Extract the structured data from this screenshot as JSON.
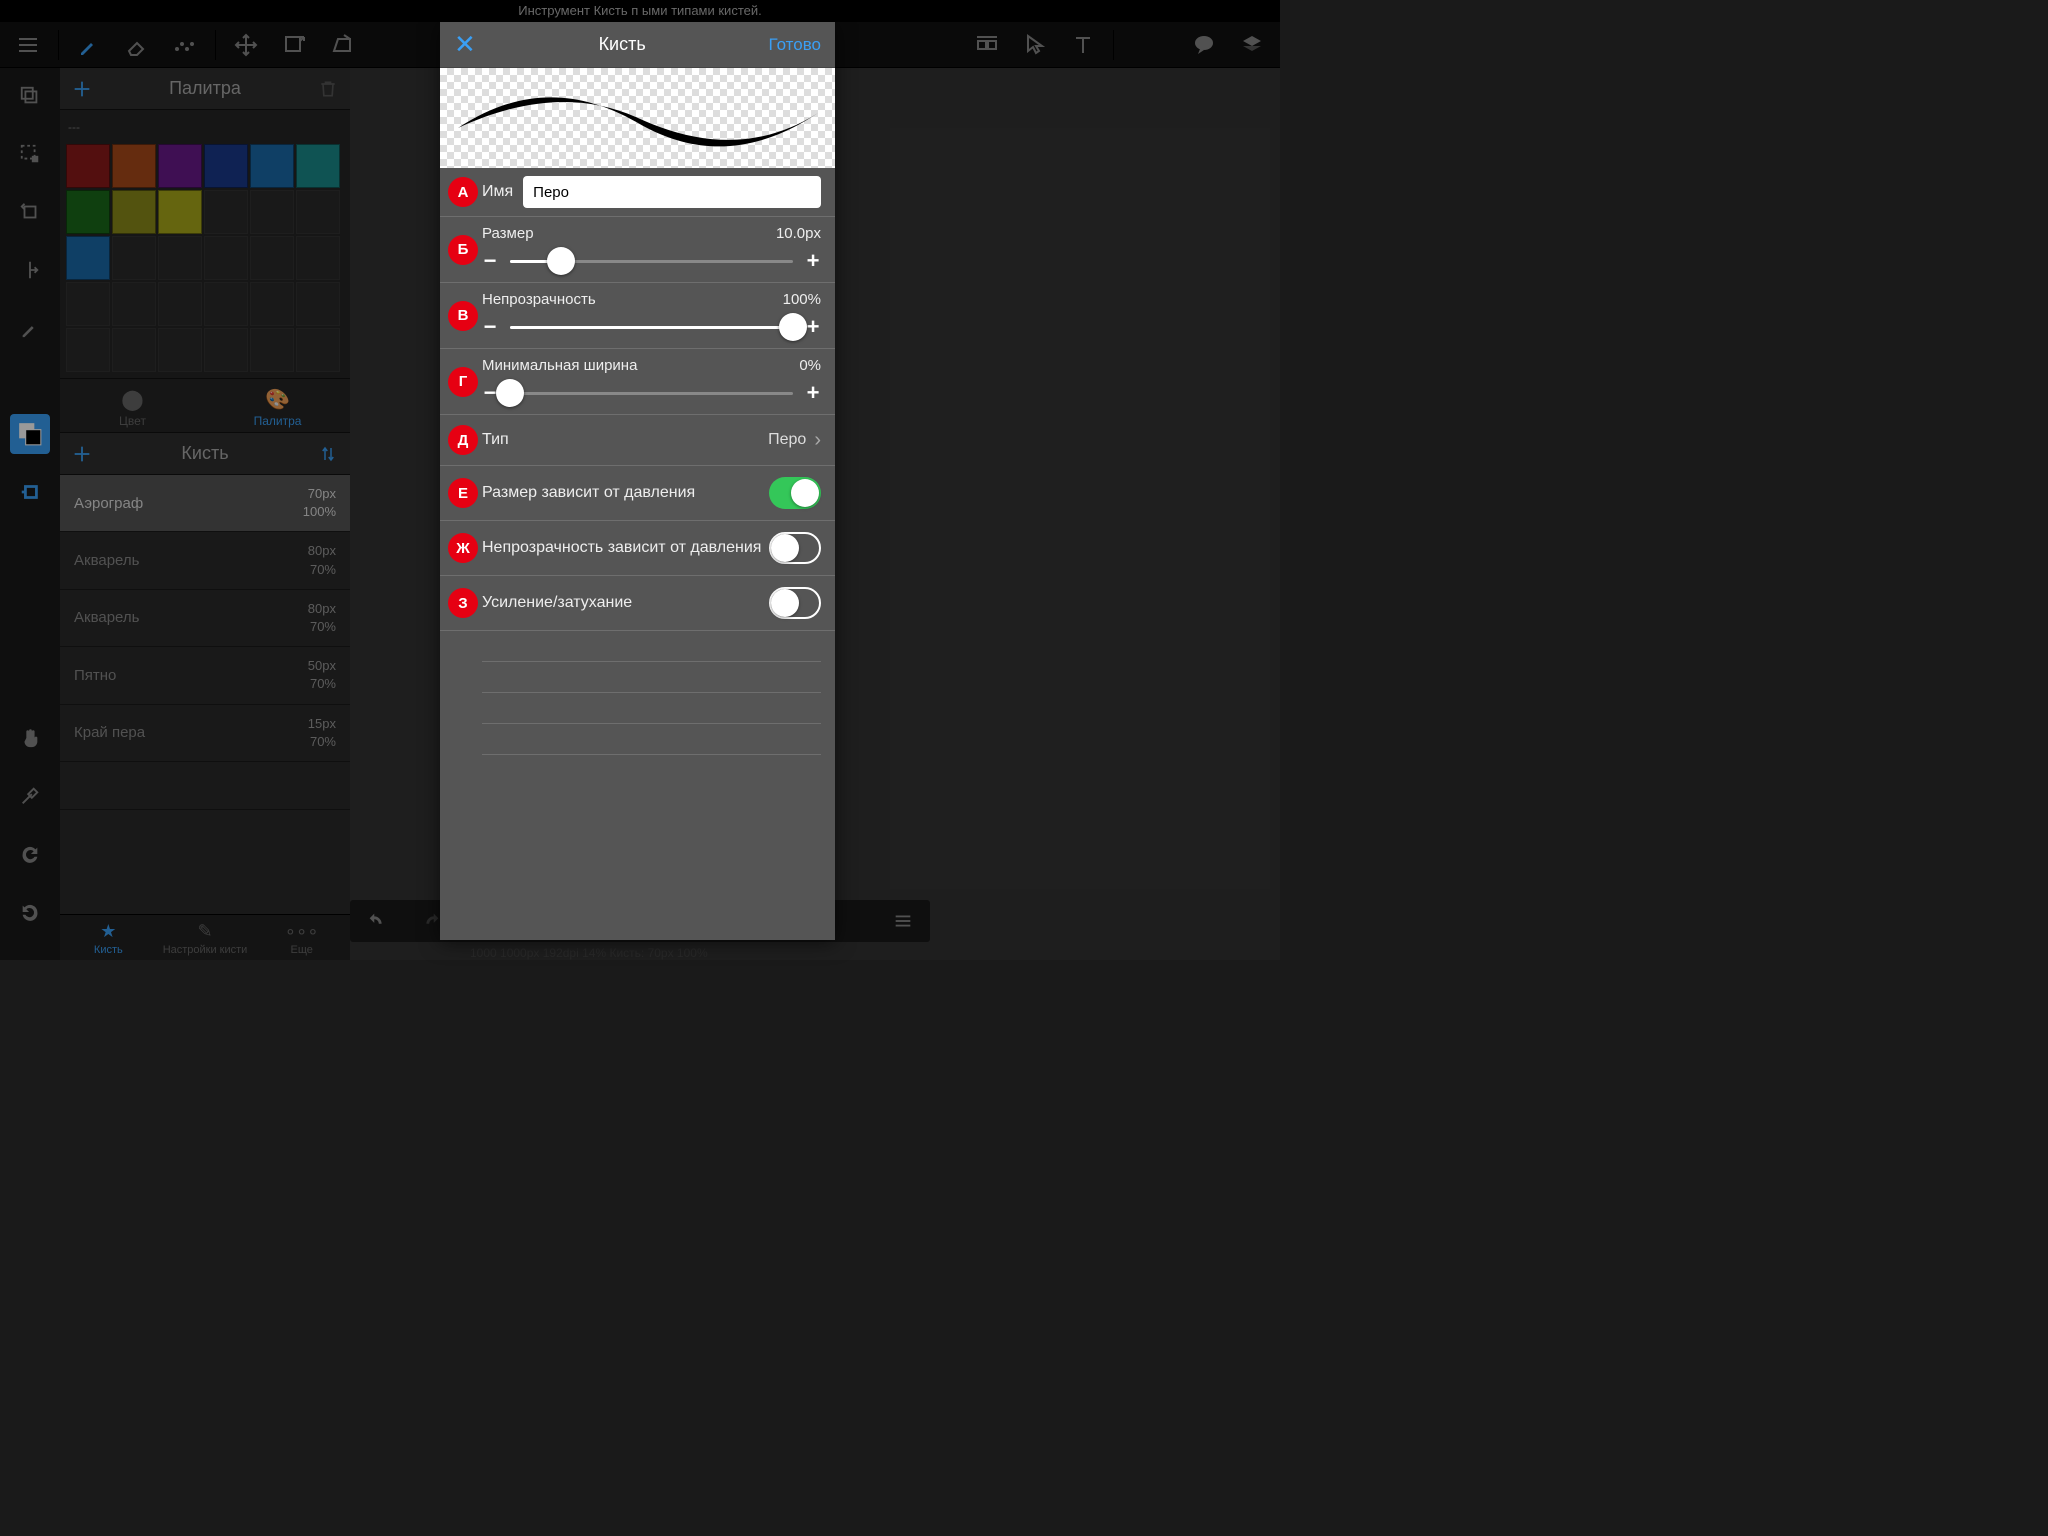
{
  "help_text": "Инструмент Кисть п                                                                                     ыми типами кистей.",
  "side_panel": {
    "palette_title": "Палитра",
    "palette_name": "---",
    "tabs": {
      "color": "Цвет",
      "palette": "Палитра"
    },
    "brush_header": "Кисть",
    "brushes": [
      {
        "name": "Аэрограф",
        "size": "70px",
        "opacity": "100%",
        "selected": true
      },
      {
        "name": "Акварель",
        "size": "80px",
        "opacity": "70%",
        "selected": false
      },
      {
        "name": "Акварель",
        "size": "80px",
        "opacity": "70%",
        "selected": false
      },
      {
        "name": "Пятно",
        "size": "50px",
        "opacity": "70%",
        "selected": false
      },
      {
        "name": "Край пера",
        "size": "15px",
        "opacity": "70%",
        "selected": false
      }
    ],
    "bottom_tabs": {
      "brush": "Кисть",
      "settings": "Настройки кисти",
      "more": "Еще"
    }
  },
  "palette_colors": [
    "#8b1a1a",
    "#a84a1a",
    "#6a1a8b",
    "#1a3a8b",
    "#1a6aa8",
    "#1a8b8b",
    "#1a6a1a",
    "#8b8b1a",
    "#a8a81a",
    "#2a2a2a",
    "#2a2a2a",
    "#2a2a2a",
    "#1a6aa8"
  ],
  "popover": {
    "title": "Кисть",
    "done": "Готово",
    "badges": [
      "А",
      "Б",
      "В",
      "Г",
      "Д",
      "Е",
      "Ж",
      "З"
    ],
    "name_label": "Имя",
    "name_value": "Перо",
    "sliders": [
      {
        "label": "Размер",
        "value": "10.0px",
        "pct": 18
      },
      {
        "label": "Непрозрачность",
        "value": "100%",
        "pct": 100
      },
      {
        "label": "Минимальная ширина",
        "value": "0%",
        "pct": 0
      }
    ],
    "type_label": "Тип",
    "type_value": "Перо",
    "toggles": [
      {
        "label": "Размер зависит от давления",
        "on": true
      },
      {
        "label": "Непрозрачность зависит от давления",
        "on": false
      },
      {
        "label": "Усиление/затухание",
        "on": false
      }
    ]
  },
  "status": "1000 1000px 192dpi 14% Кисть: 70px 100%"
}
